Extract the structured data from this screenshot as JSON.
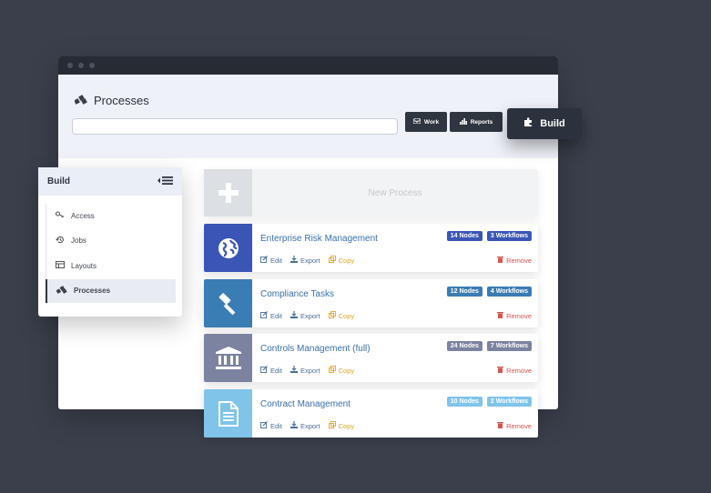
{
  "header": {
    "title": "Processes",
    "search_placeholder": ""
  },
  "toolbar": {
    "work": "Work",
    "reports": "Reports",
    "build": "Build"
  },
  "sidebar": {
    "title": "Build",
    "items": [
      {
        "label": "Access",
        "icon": "key-icon"
      },
      {
        "label": "Jobs",
        "icon": "history-icon"
      },
      {
        "label": "Layouts",
        "icon": "layout-icon"
      },
      {
        "label": "Processes",
        "icon": "processes-icon",
        "active": true
      }
    ]
  },
  "new_process": {
    "label": "New Process"
  },
  "actions": {
    "edit": "Edit",
    "export": "Export",
    "copy": "Copy",
    "remove": "Remove"
  },
  "processes": [
    {
      "name": "Enterprise Risk Management",
      "nodes": "14 Nodes",
      "workflows": "3 Workflows",
      "color": "#3a55b6",
      "icon": "globe-icon"
    },
    {
      "name": "Compliance Tasks",
      "nodes": "12 Nodes",
      "workflows": "4 Workflows",
      "color": "#3a7cb4",
      "icon": "gavel-icon"
    },
    {
      "name": "Controls Management (full)",
      "nodes": "24 Nodes",
      "workflows": "7 Workflows",
      "color": "#7b83a1",
      "icon": "bank-icon"
    },
    {
      "name": "Contract Management",
      "nodes": "10 Nodes",
      "workflows": "2 Workflows",
      "color": "#80c4ea",
      "icon": "document-icon"
    }
  ],
  "colors": {
    "accent": "#2f3640",
    "link": "#4a6e98",
    "copy": "#e1a62f",
    "remove": "#d95350"
  }
}
